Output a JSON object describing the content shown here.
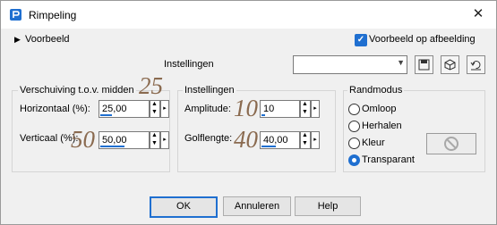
{
  "window": {
    "title": "Rimpeling",
    "close_glyph": "✕"
  },
  "header": {
    "preview_label": "Voorbeeld",
    "preview_on_image_label": "Voorbeeld op afbeelding",
    "preview_on_image_checked": true
  },
  "presets": {
    "label": "Instellingen",
    "value": ""
  },
  "groups": {
    "offset": {
      "label": "Verschuiving t.o.v. midden",
      "horizontal_label": "Horizontaal (%):",
      "horizontal_value": "25,00",
      "horizontal_fill": 0.25,
      "vertical_label": "Verticaal (%):",
      "vertical_value": "50,00",
      "vertical_fill": 0.5,
      "annot_h": "25",
      "annot_v": "50"
    },
    "settings": {
      "label": "Instellingen",
      "amplitude_label": "Amplitude:",
      "amplitude_value": "10",
      "amplitude_fill": 0.1,
      "wavelength_label": "Golflengte:",
      "wavelength_value": "40,00",
      "wavelength_fill": 0.4,
      "annot_amp": "10",
      "annot_wave": "40"
    },
    "edge": {
      "label": "Randmodus",
      "options": [
        "Omloop",
        "Herhalen",
        "Kleur",
        "Transparant"
      ],
      "selected_index": 3
    }
  },
  "buttons": {
    "ok": "OK",
    "cancel": "Annuleren",
    "help": "Help"
  },
  "colors": {
    "accent": "#1f6fd0",
    "annotation": "#8a6a4f"
  }
}
